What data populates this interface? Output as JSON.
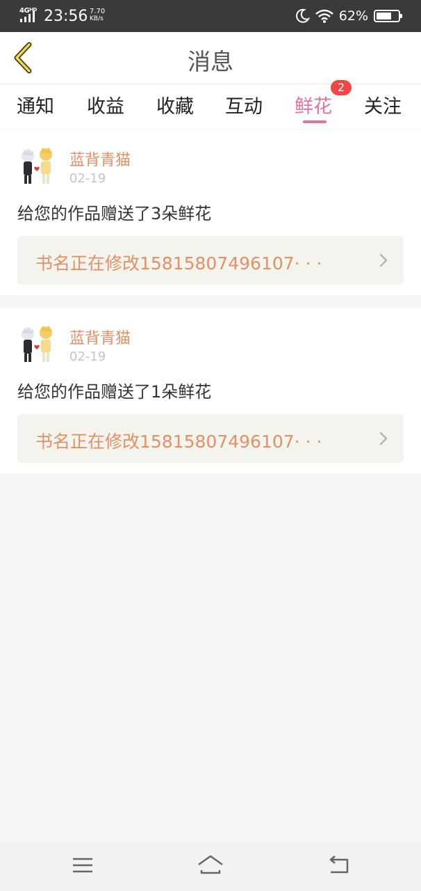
{
  "status_bar": {
    "network": "4G",
    "network_sup": "HD",
    "time": "23:56",
    "speed_value": "7.70",
    "speed_unit": "KB/s",
    "battery_percent": "62%",
    "icons": [
      "signal-icon",
      "moon-icon",
      "wifi-icon",
      "battery-icon"
    ]
  },
  "header": {
    "title": "消息",
    "back_icon": "chevron-left-icon"
  },
  "tabs": {
    "items": [
      {
        "label": "通知"
      },
      {
        "label": "收益"
      },
      {
        "label": "收藏"
      },
      {
        "label": "互动"
      },
      {
        "label": "鲜花",
        "badge": "2",
        "active": true
      },
      {
        "label": "关注"
      }
    ]
  },
  "messages": [
    {
      "username": "蓝背青猫",
      "date": "02-19",
      "text": "给您的作品赠送了3朵鲜花",
      "work_title": "书名正在修改15815807496107· · ·"
    },
    {
      "username": "蓝背青猫",
      "date": "02-19",
      "text": "给您的作品赠送了1朵鲜花",
      "work_title": "书名正在修改15815807496107· · ·"
    }
  ],
  "nav": {
    "icons": [
      "menu-icon",
      "home-icon",
      "back-icon"
    ]
  },
  "colors": {
    "accent": "#e66fa3",
    "name": "#e58f66",
    "badge": "#f04646",
    "status_bar": "#3a3a3a"
  }
}
